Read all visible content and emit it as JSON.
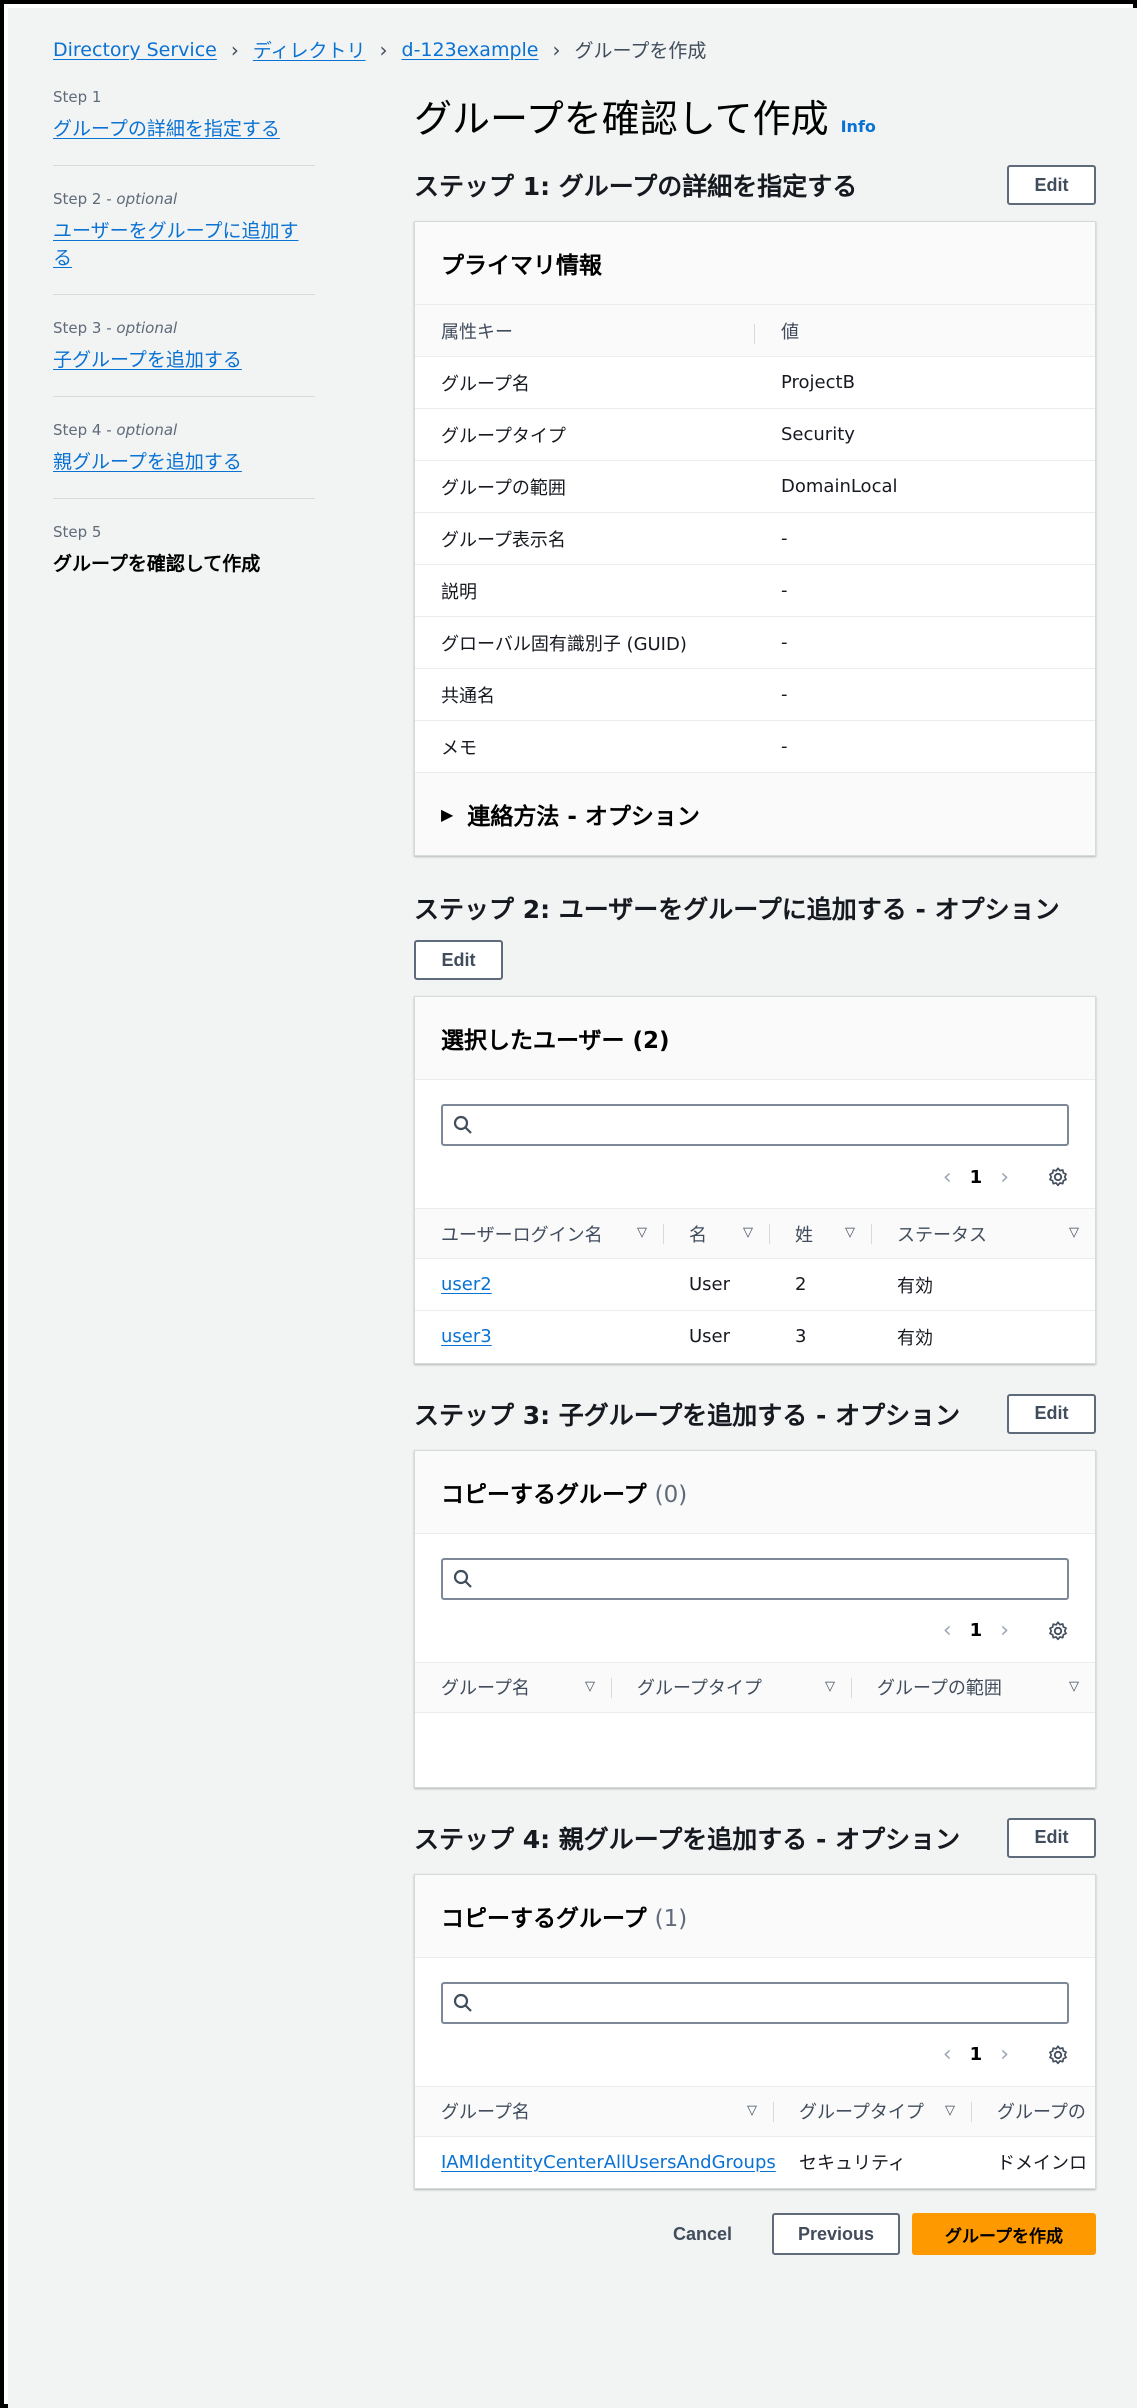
{
  "breadcrumb": {
    "items": [
      "Directory Service",
      "ディレクトリ",
      "d-123example"
    ],
    "current": "グループを作成"
  },
  "steps": [
    {
      "num": "Step 1",
      "optional": "",
      "label": "グループの詳細を指定する"
    },
    {
      "num": "Step 2",
      "optional": "optional",
      "label": "ユーザーをグループに追加する"
    },
    {
      "num": "Step 3",
      "optional": "optional",
      "label": "子グループを追加する"
    },
    {
      "num": "Step 4",
      "optional": "optional",
      "label": "親グループを追加する"
    },
    {
      "num": "Step 5",
      "optional": "",
      "label": "グループを確認して作成"
    }
  ],
  "page": {
    "title": "グループを確認して作成",
    "info": "Info"
  },
  "edit_label": "Edit",
  "step1": {
    "title": "ステップ 1: グループの詳細を指定する",
    "card_title": "プライマリ情報",
    "head_key": "属性キー",
    "head_value": "値",
    "rows": [
      {
        "k": "グループ名",
        "v": "ProjectB"
      },
      {
        "k": "グループタイプ",
        "v": "Security"
      },
      {
        "k": "グループの範囲",
        "v": "DomainLocal"
      },
      {
        "k": "グループ表示名",
        "v": "-"
      },
      {
        "k": "説明",
        "v": "-"
      },
      {
        "k": "グローバル固有識別子 (GUID)",
        "v": "-"
      },
      {
        "k": "共通名",
        "v": "-"
      },
      {
        "k": "メモ",
        "v": "-"
      }
    ],
    "expander": "連絡方法 - オプション"
  },
  "step2": {
    "title": "ステップ 2: ユーザーをグループに追加する - オプション",
    "card_title": "選択したユーザー (2)",
    "page": "1",
    "columns": [
      "ユーザーログイン名",
      "名",
      "姓",
      "ステータス"
    ],
    "rows": [
      {
        "login": "user2",
        "first": "User",
        "last": "2",
        "status": "有効"
      },
      {
        "login": "user3",
        "first": "User",
        "last": "3",
        "status": "有効"
      }
    ]
  },
  "step3": {
    "title": "ステップ 3: 子グループを追加する - オプション",
    "card_title": "コピーするグループ",
    "count": "(0)",
    "page": "1",
    "columns": [
      "グループ名",
      "グループタイプ",
      "グループの範囲"
    ]
  },
  "step4": {
    "title": "ステップ 4: 親グループを追加する - オプション",
    "card_title": "コピーするグループ",
    "count": "(1)",
    "page": "1",
    "columns": [
      "グループ名",
      "グループタイプ",
      "グループの"
    ],
    "rows": [
      {
        "name": "IAMIdentityCenterAllUsersAndGroups",
        "type": "セキュリティ",
        "scope": "ドメインロ"
      }
    ]
  },
  "footer": {
    "cancel": "Cancel",
    "previous": "Previous",
    "create": "グループを作成"
  },
  "colors": {
    "link": "#0972d3",
    "primary": "#ff9900",
    "background": "#f2f3f3"
  }
}
